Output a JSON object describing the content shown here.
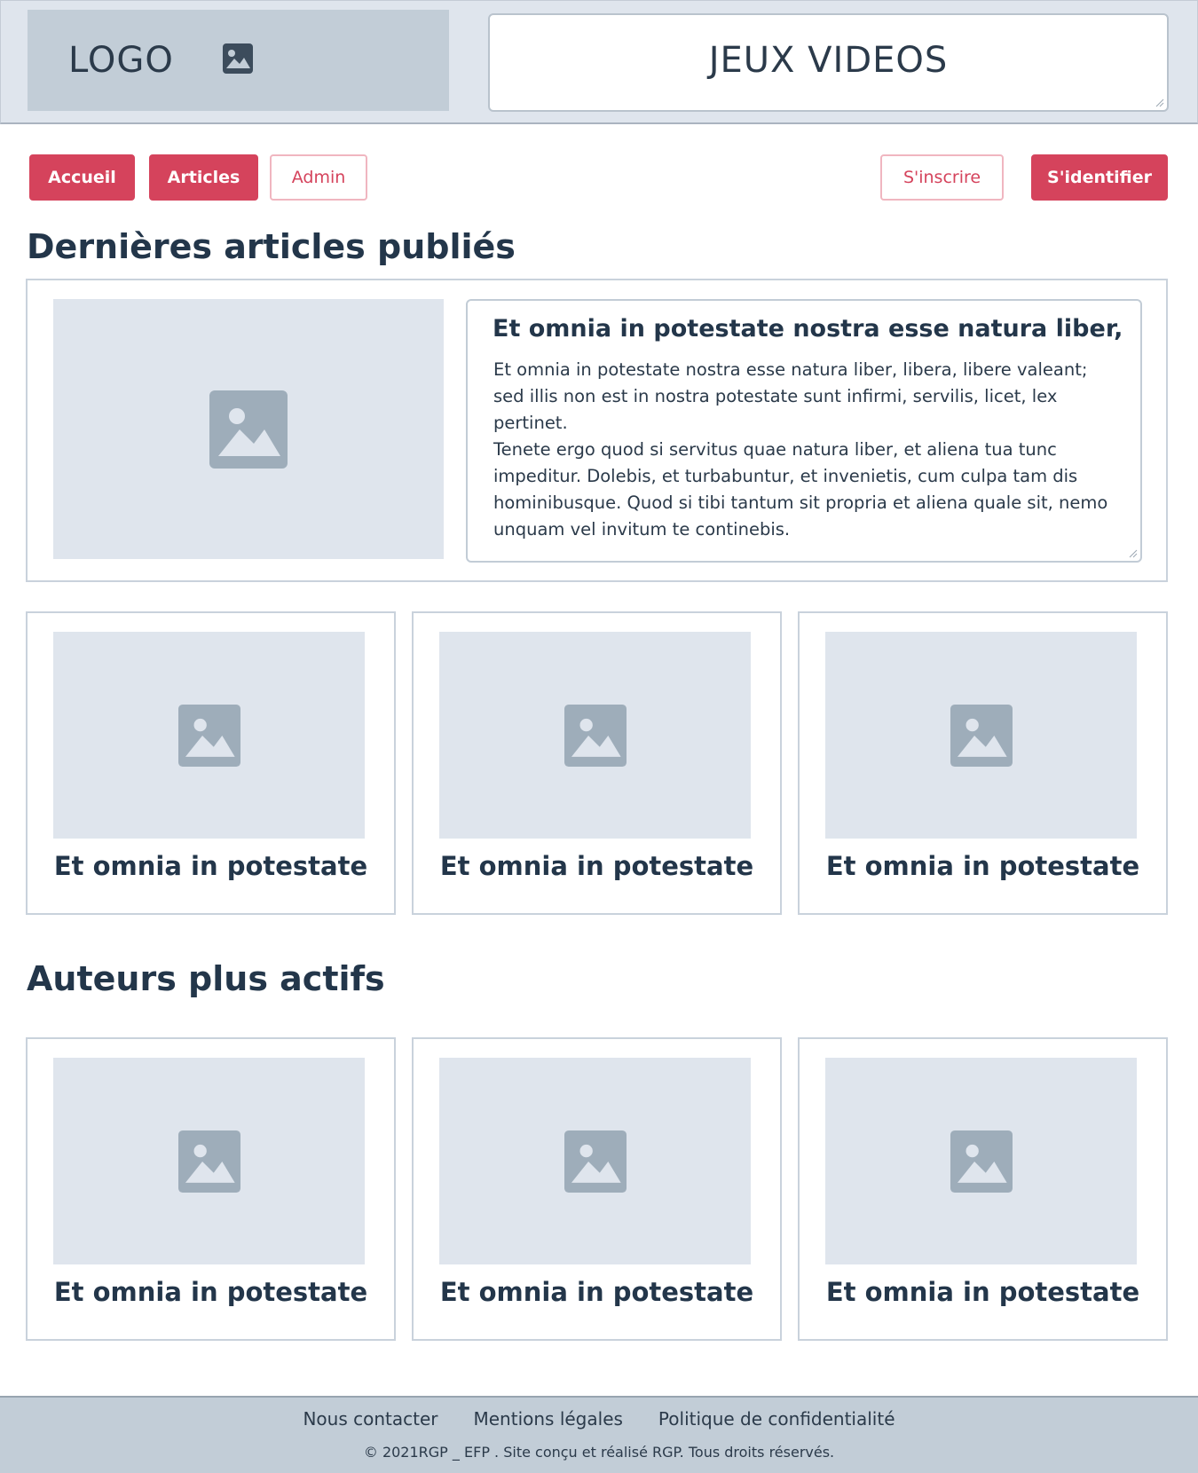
{
  "header": {
    "logo_text": "LOGO",
    "logo_icon": "image-icon",
    "site_title": "JEUX VIDEOS"
  },
  "nav": {
    "accueil": "Accueil",
    "articles": "Articles",
    "admin": "Admin",
    "sinscrire": "S'inscrire",
    "sidentifier": "S'identifier"
  },
  "colors": {
    "accent": "#d5435c",
    "placeholder_bg": "#dfe5ed",
    "placeholder_icon": "#9eadba",
    "footer_bg": "#c2cdd7"
  },
  "latest": {
    "heading": "Dernières articles publiés",
    "featured": {
      "title": "Et omnia in potestate nostra esse natura liber,",
      "paragraph1": "Et omnia in potestate nostra esse natura liber, libera, libere valeant; sed illis non est in nostra potestate sunt infirmi, servilis, licet, lex pertinet.",
      "paragraph2": "Tenete ergo quod si servitus quae natura liber, et aliena tua tunc impeditur. Dolebis, et turbabuntur, et invenietis, cum culpa tam dis hominibusque. Quod si tibi tantum sit propria et aliena quale sit, nemo unquam vel invitum te continebis."
    },
    "cards": [
      {
        "title": "Et omnia in potestate"
      },
      {
        "title": "Et omnia in potestate"
      },
      {
        "title": "Et omnia in potestate"
      }
    ]
  },
  "authors": {
    "heading": "Auteurs plus actifs",
    "cards": [
      {
        "title": "Et omnia in potestate"
      },
      {
        "title": "Et omnia in potestate"
      },
      {
        "title": "Et omnia in potestate"
      }
    ]
  },
  "footer": {
    "links": [
      "Nous contacter",
      "Mentions légales",
      "Politique de confidentialité"
    ],
    "copyright": "© 2021RGP _ EFP . Site conçu et réalisé  RGP. Tous droits réservés."
  }
}
